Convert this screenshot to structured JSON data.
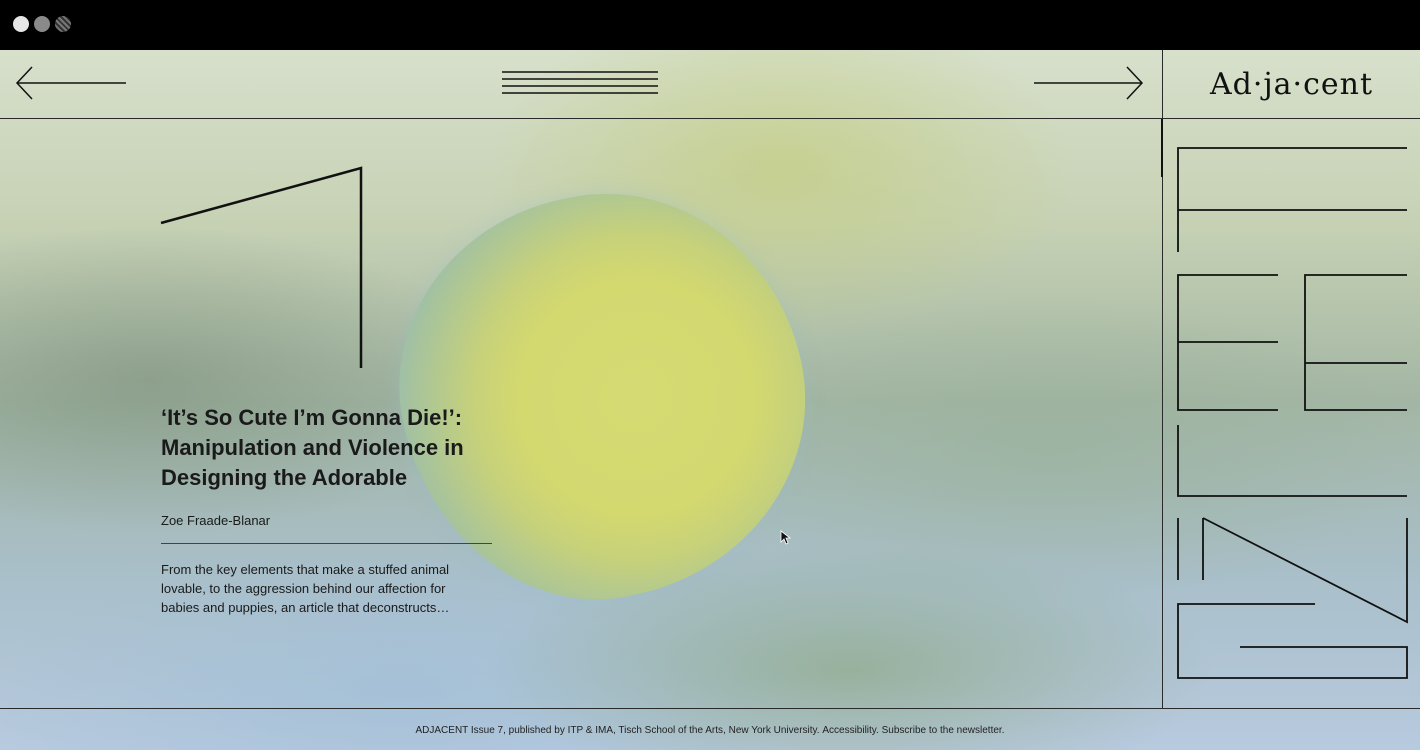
{
  "window": {
    "controls": [
      "close-dot",
      "minimize-dot",
      "maximize-dot"
    ]
  },
  "header": {
    "logo": "Ad·ja·cent",
    "prev_icon": "arrow-left-icon",
    "next_icon": "arrow-right-icon",
    "menu_icon": "menu-lines-icon"
  },
  "issue": {
    "numeral": "7",
    "side_word": "ITEM"
  },
  "article": {
    "title": "‘It’s So Cute I’m Gonna Die!’: Manipulation and Violence in Designing the Adorable",
    "author": "Zoe Fraade-Blanar",
    "excerpt": "From the key elements that make a stuffed animal lovable, to the aggression behind our affection for babies and puppies, an article that deconstructs…"
  },
  "footer": {
    "text": "ADJACENT Issue 7, published by ITP & IMA, Tisch School of the Arts, New York University.",
    "accessibility_link": "Accessibility.",
    "newsletter_link": "Subscribe to the newsletter."
  },
  "colors": {
    "ink": "#111111",
    "blob_center": "#d6da72",
    "blob_edge": "#8cb7bf"
  }
}
